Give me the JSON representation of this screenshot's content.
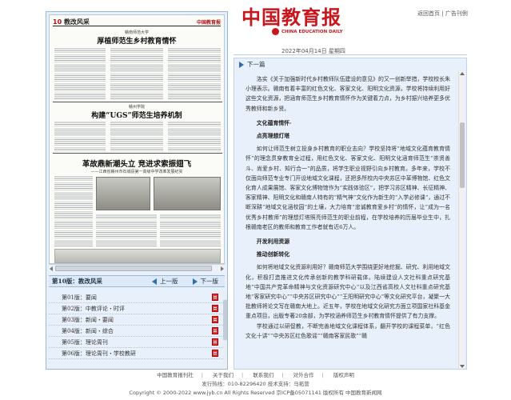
{
  "header": {
    "masthead_cn": "中国教育报",
    "masthead_en": "CHINA EDUCATION DAILY",
    "link_home": "返回首页",
    "link_sep": "|",
    "link_ad": "广告刊例",
    "date": "2022年04月14日 星期四"
  },
  "newspaper": {
    "section_no": "10",
    "section_name": "教改风采",
    "logo": "中国教育报",
    "headline1_kicker": "赣南师范大学",
    "headline1": "厚植师范生乡村教育情怀",
    "headline2_kicker": "赣州学院",
    "headline2": "构建“UGS”师范生培养机制",
    "headline3": "革故鼎新潮头立 竞进求索振翅飞",
    "headline3_sub": "——江西省赣州市石城县第一高级中学改革发展纪实"
  },
  "current_page": {
    "label": "第10版：教改风采",
    "prev": "上一版",
    "next": "下一版"
  },
  "pages": [
    {
      "label": "第01版：要闻"
    },
    {
      "label": "第02版：中教评论・时评"
    },
    {
      "label": "第03版：新闻・要闻"
    },
    {
      "label": "第04版：新闻・综合"
    },
    {
      "label": "第05版：理论周刊"
    },
    {
      "label": "第06版：理论周刊・学校教研"
    }
  ],
  "article_nav": {
    "next": "下一篇"
  },
  "article": {
    "p0": "洛实《关于加强新时代乡村教师队伍建设的意见》的又一创新举措，学校校长朱小理表示。赣南有着丰富的红色文化、客家文化、阳明文化资源，学校将持续利用好这些文化资源，把涵育师范生乡村教育情怀作为关键着力点，为乡村振兴培养更多优秀教师和新乡贤。",
    "h1": "文化蕴育情怀·",
    "h2": "点亮理想灯塔",
    "p1": "如何让师范生树立投身乡村教育的职业志向？学校坚持将“地域文化蕴育教育情怀”的理念贯穿教育全过程，用红色文化、客家文化、阳明文化涵育师范生“崇贤善斗、尚爱乡村、知行合一”的品质，将学生职业视野引向乡村教育。多年来，学校不仅面向师范专业专门开设地域文化课程，还把多所校内中央苏区中革博物馆、红色文化育人成果展馆、客家文化博物馆作为“实践体验区”，把学习苏区精神、长征精神、客家精神、阳明文化和赣南人特有的“精气神”文化作为新生的“入学必修课”，通过不断深耕“地域文化涵校园”的土壤，大力培育“忠诚教育爱乡村”的情怀，让“成为一名优秀乡村教师”的理想灯塔照亮师范生的职业前程，在学校培养的历届毕业生中，扎根赣南老区的教师和教育工作者就有近6万人。",
    "h3": "开发利用资源",
    "h4": "推动创新转化",
    "p2": "如何将地域文化资源利用好？赣南师范大学围绕更好地挖掘、研究、利用地域文化，积极打造推进文化传承创新的教学科研载体。陆续建设人文社科重点研究基地“中国共产党革命精神与文化资源研究中心”以及江西省高校人文社科重点研究基地“客家研究中心”“中央苏区研究中心”“王阳明研究中心”等文化研究平台，凝聚一大批教师将论文写在赣南大地上。近五年，学校在地域文化研究方面立项国家社科基金重点项目，出版专著20余部，为学校涵养师范生乡村教育情怀提供了有力支撑。",
    "p3": "学校通过以研促教，不断完善地域文化课程体系，翻开学校的课程菜单，“红色文化十讲”“中央苏区红色歌谣”“赣南客家民歌”“赣"
  },
  "footer": {
    "links": [
      "中国教育报刊社",
      "关于我们",
      "联系我们",
      "对外合作",
      "版权声明"
    ],
    "line2": "发行热线：010-82296420 技术支持：马拓营",
    "line3": "Copyright © 2000-2022 www.jyb.cn All Rights Reserved 京ICP备05071141 版权所有 中国教育新闻网"
  }
}
